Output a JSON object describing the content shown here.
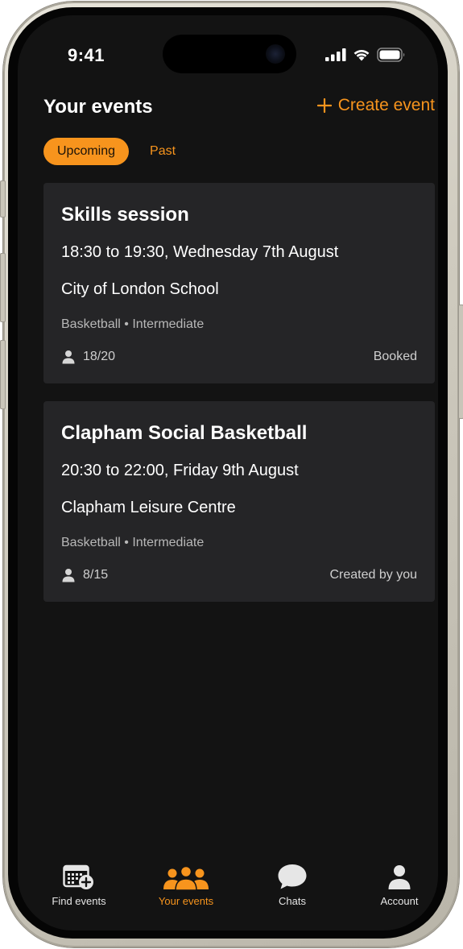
{
  "status_bar": {
    "time": "9:41"
  },
  "header": {
    "title": "Your events",
    "create_label": "Create event"
  },
  "tabs": [
    {
      "label": "Upcoming",
      "active": true
    },
    {
      "label": "Past",
      "active": false
    }
  ],
  "events": [
    {
      "title": "Skills session",
      "time": "18:30 to 19:30, Wednesday 7th August",
      "venue": "City of London School",
      "tags": "Basketball • Intermediate",
      "attendance": "18/20",
      "status": "Booked"
    },
    {
      "title": "Clapham Social Basketball",
      "time": "20:30 to 22:00, Friday 9th August",
      "venue": "Clapham Leisure Centre",
      "tags": "Basketball • Intermediate",
      "attendance": "8/15",
      "status": "Created by you"
    }
  ],
  "bottom_nav": [
    {
      "label": "Find events",
      "icon": "calendar-add-icon",
      "active": false
    },
    {
      "label": "Your events",
      "icon": "people-group-icon",
      "active": true
    },
    {
      "label": "Chats",
      "icon": "chat-bubble-icon",
      "active": false
    },
    {
      "label": "Account",
      "icon": "person-icon",
      "active": false
    }
  ],
  "colors": {
    "accent": "#f7941d",
    "background": "#131313",
    "card": "#252527"
  }
}
